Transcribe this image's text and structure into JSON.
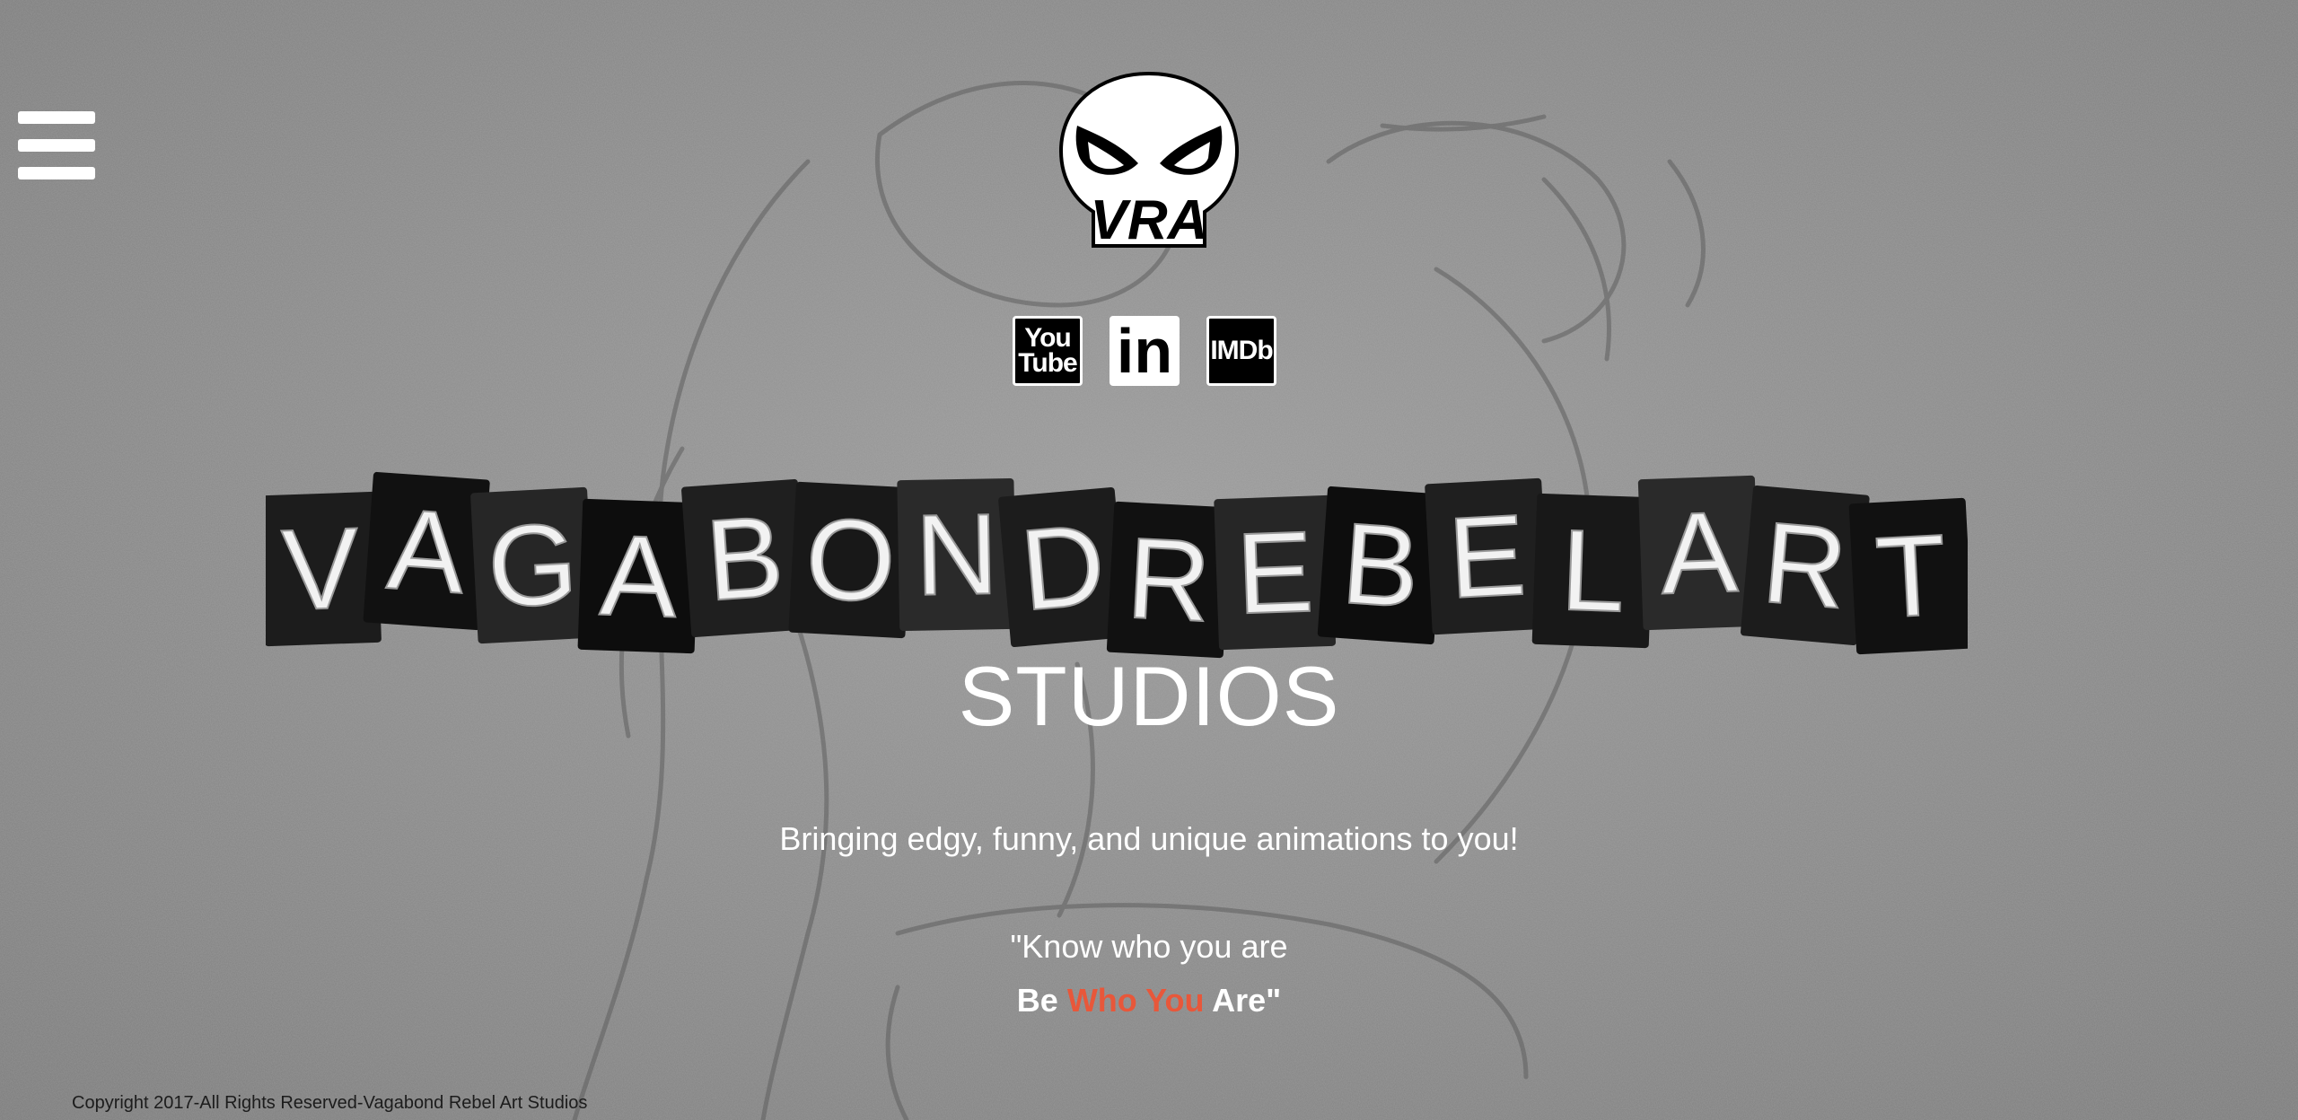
{
  "nav": {
    "menu_icon": "hamburger-menu-icon"
  },
  "logo": {
    "text": "VRA",
    "icon": "skull-logo"
  },
  "social": [
    {
      "name": "YouTube",
      "label_top": "You",
      "label_bottom": "Tube"
    },
    {
      "name": "LinkedIn",
      "label": "in"
    },
    {
      "name": "IMDb",
      "label": "IMDb"
    }
  ],
  "hero": {
    "title_words": [
      "VAGABOND",
      "REBEL",
      "ART"
    ],
    "studios": "STUDIOS",
    "tagline": "Bringing edgy, funny, and unique animations to you!",
    "quote_line1": "\"Know who you are",
    "quote_be": "Be",
    "quote_who_you": "Who You",
    "quote_are": "Are\""
  },
  "footer": {
    "copyright": "Copyright 2017-All Rights Reserved-Vagabond Rebel Art Studios"
  },
  "colors": {
    "accent": "#e8573a",
    "background": "#8a8a8a",
    "tile": "#151515"
  }
}
